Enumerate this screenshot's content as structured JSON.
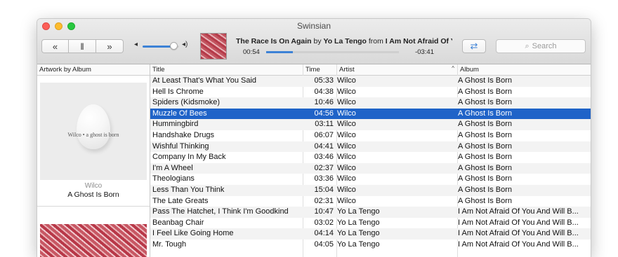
{
  "window": {
    "title": "Swinsian"
  },
  "transport": {
    "prev_icon": "«",
    "pause_icon": "‖",
    "next_icon": "»"
  },
  "volume": {
    "level": 0.85
  },
  "now_playing": {
    "title": "The Race Is On Again",
    "by": "by",
    "artist": "Yo La Tengo",
    "from": "from",
    "album": "I Am Not Afraid Of You And Will Beat Your Ass",
    "elapsed": "00:54",
    "remaining": "-03:41",
    "progress": 0.2
  },
  "search": {
    "placeholder": "Search"
  },
  "sidebar": {
    "header": "Artwork by Album",
    "albums": [
      {
        "cover_text": "Wilco • a ghost is born",
        "artist": "Wilco",
        "album": "A Ghost Is Born"
      }
    ]
  },
  "columns": {
    "title": "Title",
    "time": "Time",
    "artist": "Artist",
    "album": "Album"
  },
  "tracks": [
    {
      "title": "At Least That's What You Said",
      "time": "05:33",
      "artist": "Wilco",
      "album": "A Ghost Is Born"
    },
    {
      "title": "Hell Is Chrome",
      "time": "04:38",
      "artist": "Wilco",
      "album": "A Ghost Is Born"
    },
    {
      "title": "Spiders (Kidsmoke)",
      "time": "10:46",
      "artist": "Wilco",
      "album": "A Ghost Is Born"
    },
    {
      "title": "Muzzle Of Bees",
      "time": "04:56",
      "artist": "Wilco",
      "album": "A Ghost Is Born"
    },
    {
      "title": "Hummingbird",
      "time": "03:11",
      "artist": "Wilco",
      "album": "A Ghost Is Born"
    },
    {
      "title": "Handshake Drugs",
      "time": "06:07",
      "artist": "Wilco",
      "album": "A Ghost Is Born"
    },
    {
      "title": "Wishful Thinking",
      "time": "04:41",
      "artist": "Wilco",
      "album": "A Ghost Is Born"
    },
    {
      "title": "Company In My Back",
      "time": "03:46",
      "artist": "Wilco",
      "album": "A Ghost Is Born"
    },
    {
      "title": "I'm A Wheel",
      "time": "02:37",
      "artist": "Wilco",
      "album": "A Ghost Is Born"
    },
    {
      "title": "Theologians",
      "time": "03:36",
      "artist": "Wilco",
      "album": "A Ghost Is Born"
    },
    {
      "title": "Less Than You Think",
      "time": "15:04",
      "artist": "Wilco",
      "album": "A Ghost Is Born"
    },
    {
      "title": "The Late Greats",
      "time": "02:31",
      "artist": "Wilco",
      "album": "A Ghost Is Born"
    },
    {
      "title": "Pass The Hatchet, I Think I'm Goodkind",
      "time": "10:47",
      "artist": "Yo La Tengo",
      "album": "I Am Not Afraid Of You And Will B..."
    },
    {
      "title": "Beanbag Chair",
      "time": "03:02",
      "artist": "Yo La Tengo",
      "album": "I Am Not Afraid Of You And Will B..."
    },
    {
      "title": "I Feel Like Going Home",
      "time": "04:14",
      "artist": "Yo La Tengo",
      "album": "I Am Not Afraid Of You And Will B..."
    },
    {
      "title": "Mr. Tough",
      "time": "04:05",
      "artist": "Yo La Tengo",
      "album": "I Am Not Afraid Of You And Will B..."
    }
  ],
  "selected_index": 3,
  "colors": {
    "selection": "#1f63c8",
    "accent": "#3d82d6"
  }
}
